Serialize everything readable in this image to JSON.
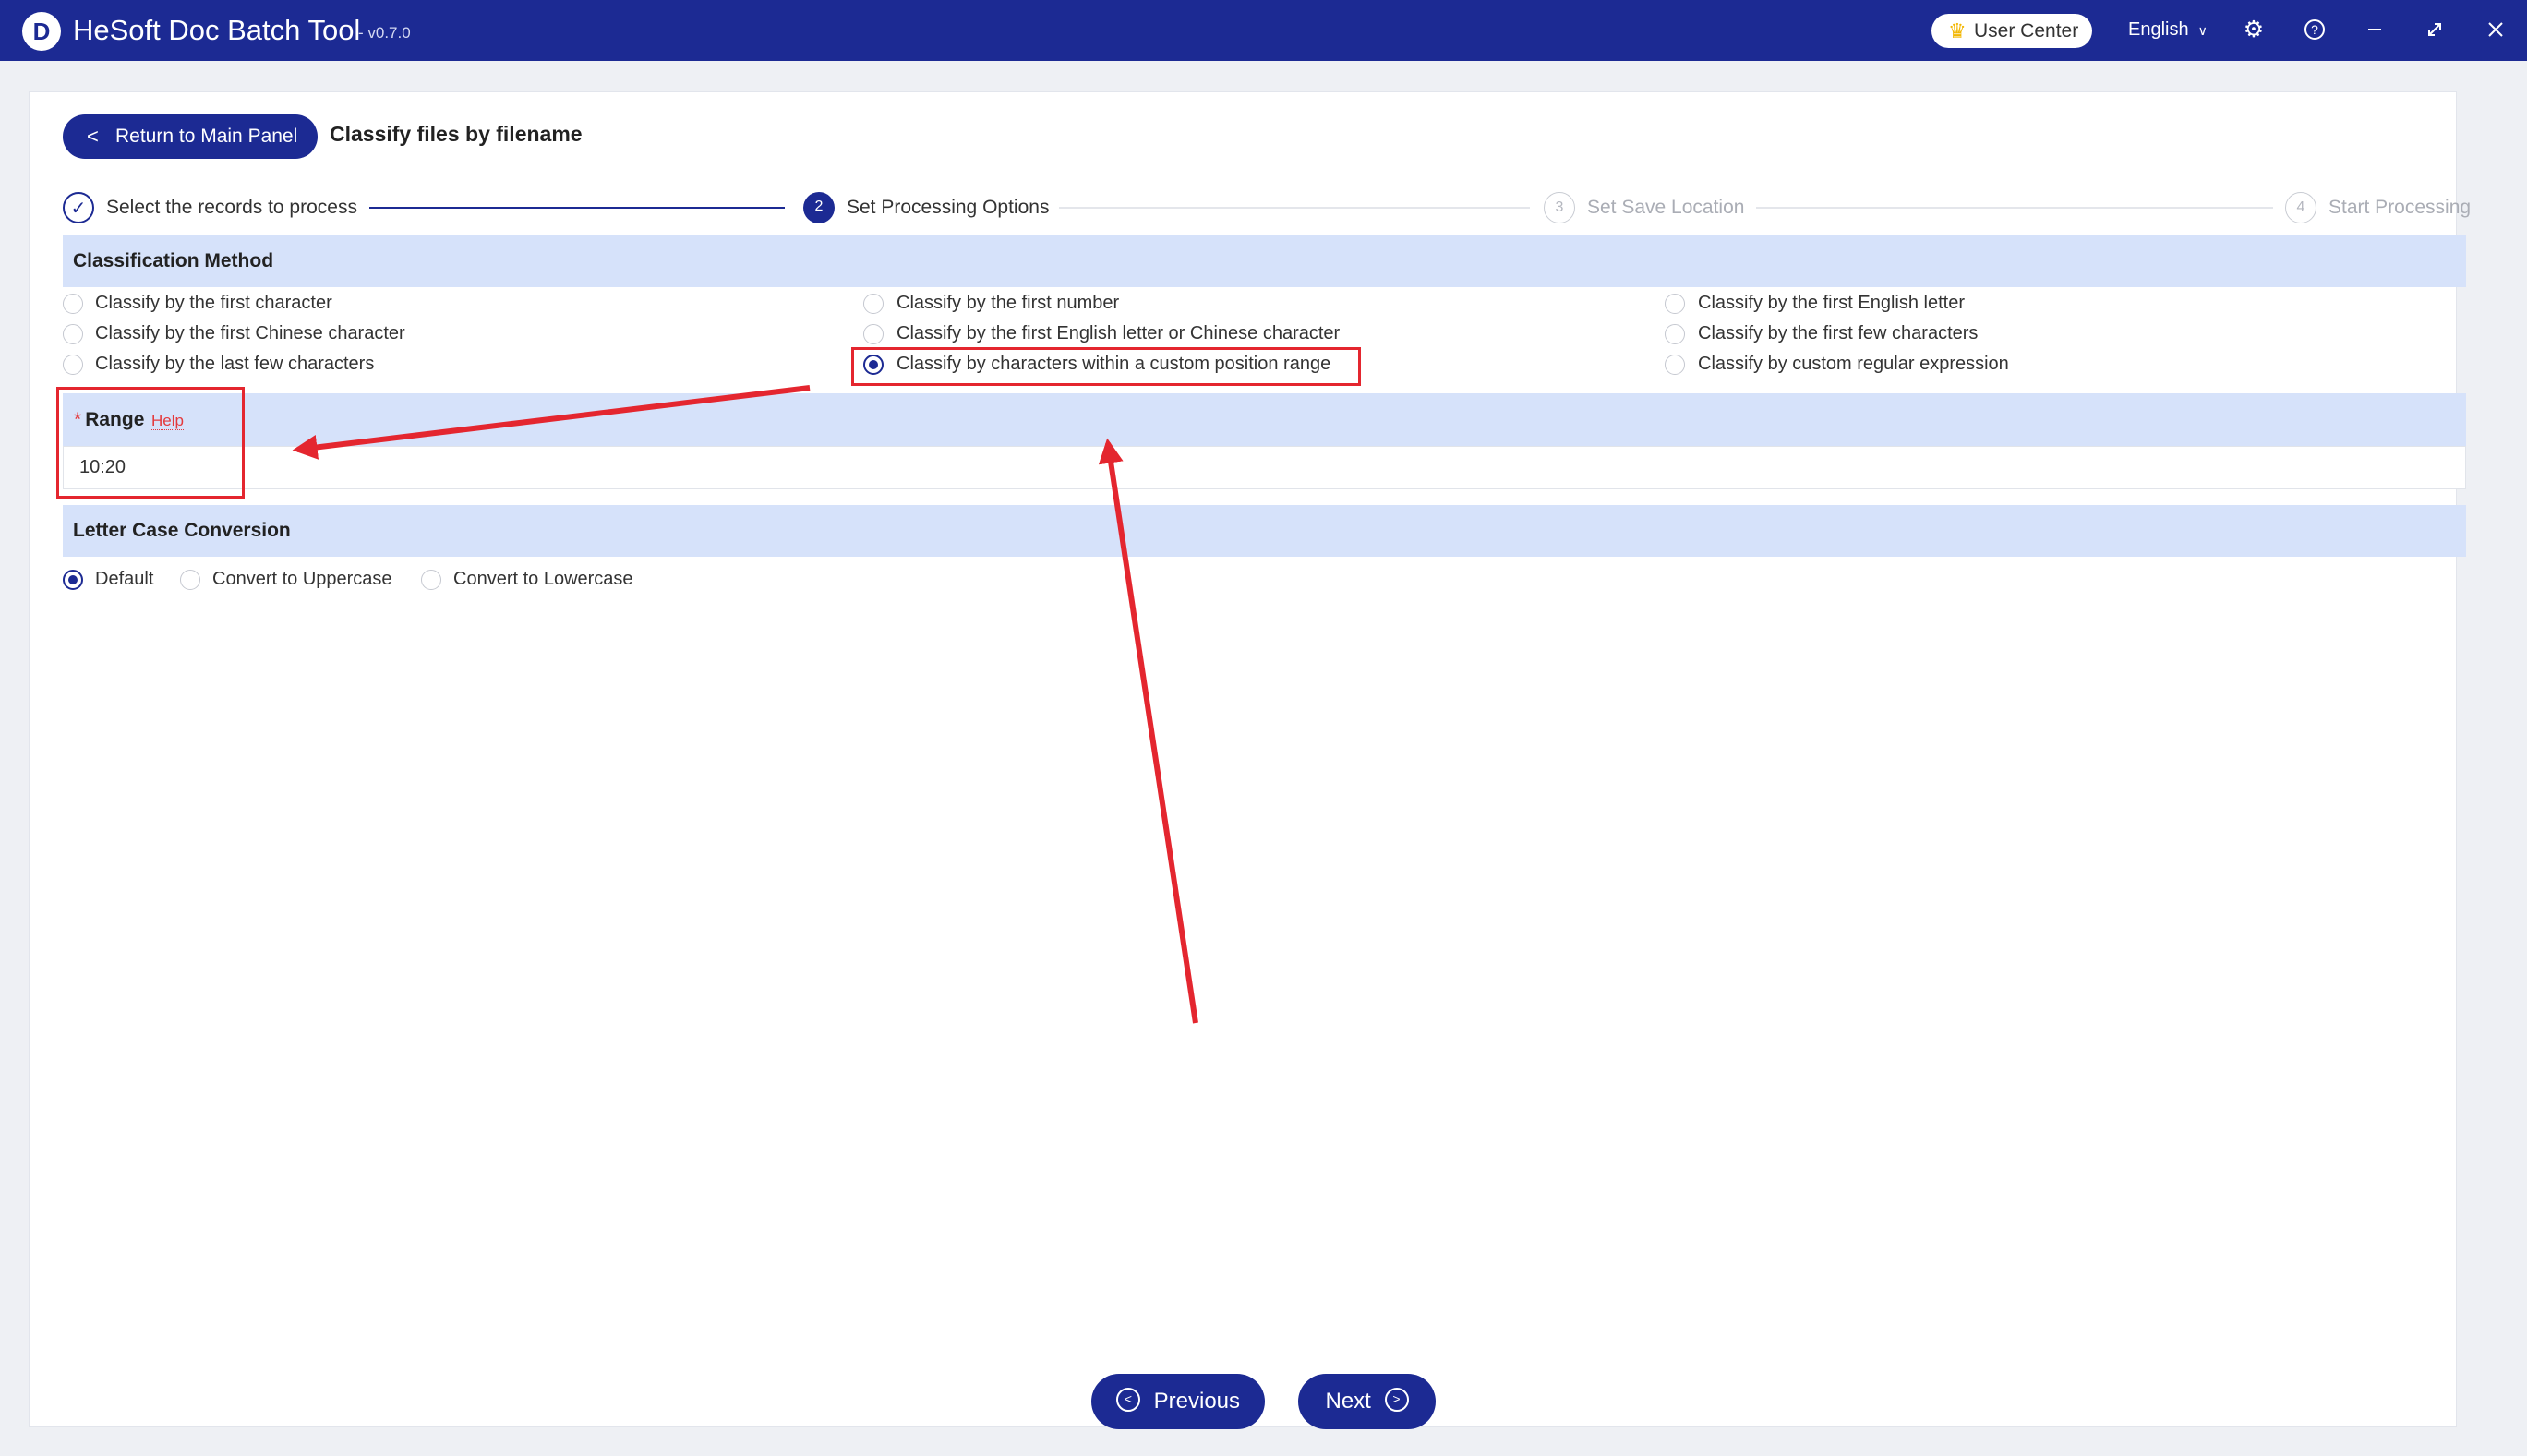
{
  "titlebar": {
    "app_name": "HeSoft Doc Batch Tool",
    "version": "- v0.7.0",
    "user_center": "User Center",
    "language": "English",
    "icons": [
      "settings-gear-icon",
      "help-icon",
      "minimize-icon",
      "maximize-icon",
      "close-icon"
    ]
  },
  "header": {
    "back_label": "Return to Main Panel",
    "title": "Classify files by filename"
  },
  "steps": [
    {
      "number": "1",
      "label": "Select the records to process",
      "state": "done"
    },
    {
      "number": "2",
      "label": "Set Processing Options",
      "state": "active"
    },
    {
      "number": "3",
      "label": "Set Save Location",
      "state": "pending"
    },
    {
      "number": "4",
      "label": "Start Processing",
      "state": "pending"
    }
  ],
  "classification": {
    "title": "Classification Method",
    "options": [
      "Classify by the first character",
      "Classify by the first number",
      "Classify by the first English letter",
      "Classify by the first Chinese character",
      "Classify by the first English letter or Chinese character",
      "Classify by the first few characters",
      "Classify by the last few characters",
      "Classify by characters within a custom position range",
      "Classify by custom regular expression"
    ],
    "selected": "Classify by characters within a custom position range"
  },
  "range": {
    "required_mark": "*",
    "label": "Range",
    "help": "Help",
    "value": "10:20"
  },
  "letter_case": {
    "title": "Letter Case Conversion",
    "options": [
      "Default",
      "Convert to Uppercase",
      "Convert to Lowercase"
    ],
    "selected": "Default"
  },
  "footer": {
    "previous": "Previous",
    "next": "Next"
  },
  "colors": {
    "primary": "#1c2a93",
    "section_bg": "#d6e2fa",
    "annotation": "#e4262f"
  }
}
